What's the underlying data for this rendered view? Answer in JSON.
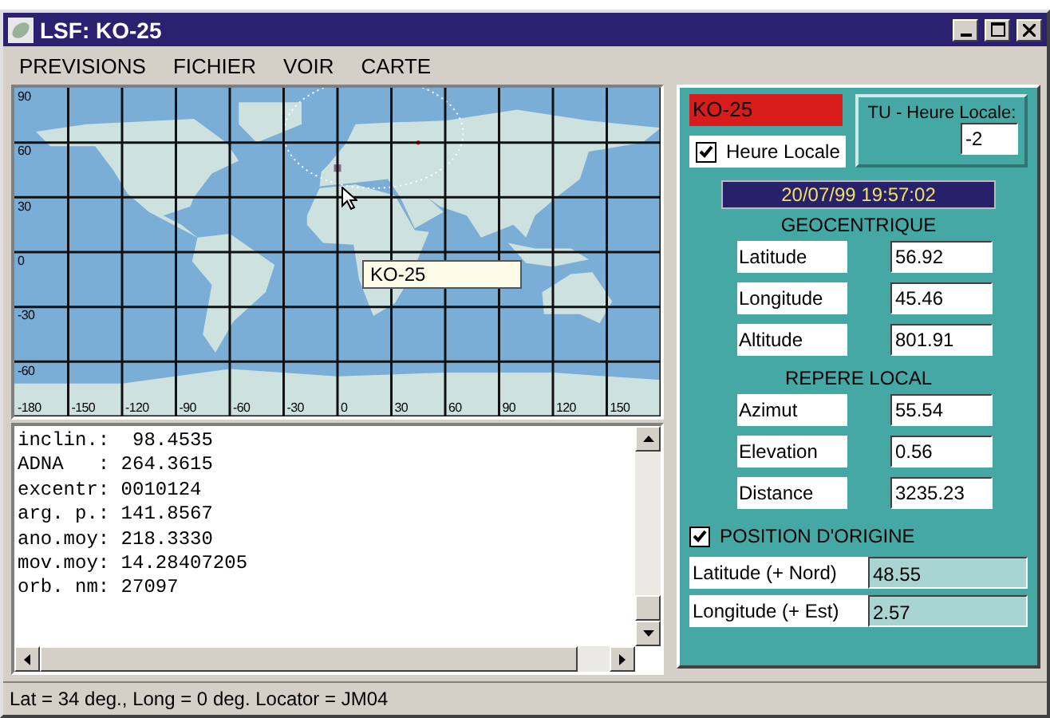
{
  "window": {
    "title": "LSF: KO-25"
  },
  "menu": [
    {
      "label": "PREVISIONS"
    },
    {
      "label": "FICHIER"
    },
    {
      "label": "VOIR"
    },
    {
      "label": "CARTE"
    }
  ],
  "map": {
    "lat_labels": [
      "90",
      "60",
      "30",
      "0",
      "-30",
      "-60"
    ],
    "lon_labels": [
      "-180",
      "-150",
      "-120",
      "-90",
      "-60",
      "-30",
      "0",
      "30",
      "60",
      "90",
      "120",
      "150"
    ],
    "tooltip": "KO-25"
  },
  "elements": [
    "inclin.:  98.4535",
    "ADNA   : 264.3615",
    "excentr: 0010124",
    "arg. p.: 141.8567",
    "ano.moy: 218.3330",
    "mov.moy: 14.28407205",
    "orb. nm: 27097"
  ],
  "status_bar": "Lat = 34 deg., Long = 0 deg. Locator = JM04",
  "panel": {
    "satellite": "KO-25",
    "local_time": {
      "label": "Heure Locale",
      "checked": true
    },
    "offset": {
      "label": "TU - Heure Locale:",
      "value": "-2"
    },
    "datetime": "20/07/99 19:57:02",
    "sections": [
      {
        "title": "GEOCENTRIQUE",
        "rows": [
          {
            "label": "Latitude",
            "value": "56.92"
          },
          {
            "label": "Longitude",
            "value": "45.46"
          },
          {
            "label": "Altitude",
            "value": "801.91"
          }
        ]
      },
      {
        "title": "REPERE LOCAL",
        "rows": [
          {
            "label": "Azimut",
            "value": "55.54"
          },
          {
            "label": "Elevation",
            "value": "0.56"
          },
          {
            "label": "Distance",
            "value": "3235.23"
          }
        ]
      }
    ],
    "origin": {
      "label": "POSITION D'ORIGINE",
      "checked": true,
      "rows": [
        {
          "label": "Latitude (+ Nord)",
          "value": "48.55"
        },
        {
          "label": "Longitude (+ Est)",
          "value": "2.57"
        }
      ]
    }
  }
}
